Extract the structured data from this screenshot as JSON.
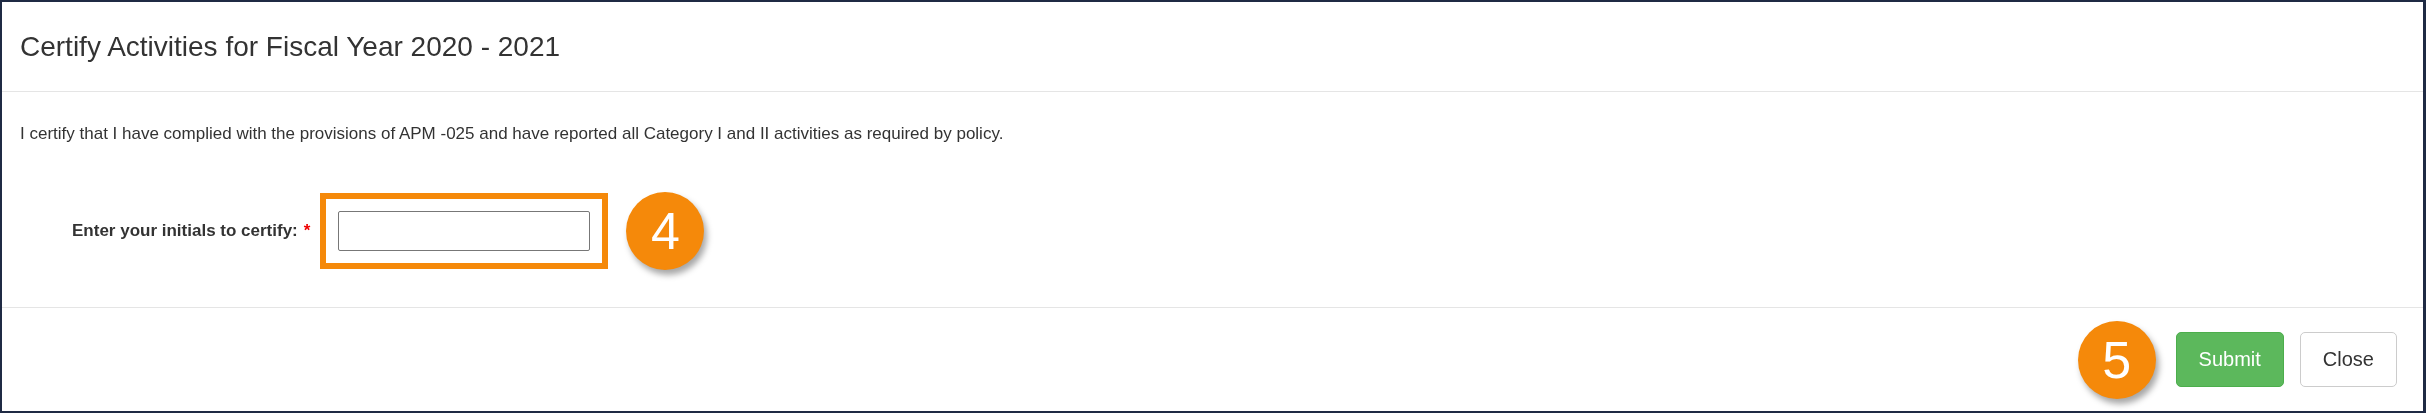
{
  "dialog": {
    "title": "Certify Activities for Fiscal Year 2020 - 2021"
  },
  "statement": "I certify that I have complied with the provisions of APM -025 and have reported all Category I and II activities as required by policy.",
  "initials_field": {
    "label": "Enter your initials to certify:",
    "required_mark": "*",
    "callout": "4",
    "highlighted": true
  },
  "footer": {
    "callout": "5",
    "buttons": [
      {
        "label": "Submit",
        "kind": "primary"
      },
      {
        "label": "Close",
        "kind": "default"
      }
    ]
  }
}
